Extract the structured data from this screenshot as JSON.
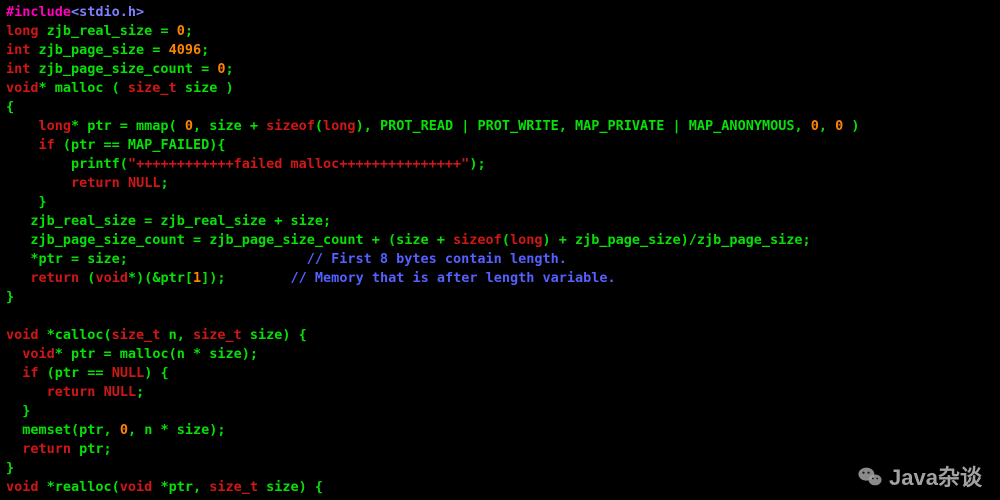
{
  "code": {
    "include_directive": "#include",
    "include_header": "<stdio.h>",
    "l2_t": "long",
    "l2_a": " zjb_real_size = ",
    "l2_v": "0",
    "l2_e": ";",
    "l3_t": "int",
    "l3_a": " zjb_page_size = ",
    "l3_v": "4096",
    "l3_e": ";",
    "l4_t": "int",
    "l4_a": " zjb_page_size_count = ",
    "l4_v": "0",
    "l4_e": ";",
    "l5_t1": "void",
    "l5_a": "* malloc ( ",
    "l5_t2": "size_t",
    "l5_b": " size )",
    "brace_open": "{",
    "brace_close": "}",
    "l7_i": "    ",
    "l7_t": "long",
    "l7_a": "* ptr = mmap( ",
    "l7_v1": "0",
    "l7_b": ", size + ",
    "l7_k": "sizeof",
    "l7_c": "(",
    "l7_t2": "long",
    "l7_d": "), PROT_READ | PROT_WRITE, MAP_PRIVATE | MAP_ANONYMOUS, ",
    "l7_v2": "0",
    "l7_com": ", ",
    "l7_v3": "0",
    "l7_e": " )",
    "l8_i": "    ",
    "l8_k": "if",
    "l8_a": " (ptr == MAP_FAILED){",
    "l9_i": "        ",
    "l9_a": "printf(",
    "l9_s": "\"++++++++++++failed malloc+++++++++++++++\"",
    "l9_b": ");",
    "l10_i": "        ",
    "l10_k": "return",
    "l10_sp": " ",
    "l10_v": "NULL",
    "l10_e": ";",
    "l11_i": "    ",
    "l11_a": "}",
    "l12_i": "   ",
    "l12_a": "zjb_real_size = zjb_real_size + size;",
    "l13_i": "   ",
    "l13_a": "zjb_page_size_count = zjb_page_size_count + (size + ",
    "l13_k": "sizeof",
    "l13_b": "(",
    "l13_t": "long",
    "l13_c": ") + zjb_page_size)/zjb_page_size;",
    "l14_i": "   ",
    "l14_a": "*ptr = size;",
    "l14_pad": "                      ",
    "l14_c": "// First 8 bytes contain length.",
    "l15_i": "   ",
    "l15_k": "return",
    "l15_a": " (",
    "l15_t": "void",
    "l15_b": "*)(&ptr[",
    "l15_v": "1",
    "l15_c": "]);",
    "l15_pad": "        ",
    "l15_cm": "// Memory that is after length variable.",
    "blank": "",
    "l18_t1": "void",
    "l18_a": " *calloc(",
    "l18_t2": "size_t",
    "l18_b": " n, ",
    "l18_t3": "size_t",
    "l18_c": " size) {",
    "l19_i": "  ",
    "l19_t": "void",
    "l19_a": "* ptr = malloc(n * size);",
    "l20_i": "  ",
    "l20_k": "if",
    "l20_a": " (ptr == ",
    "l20_v": "NULL",
    "l20_b": ") {",
    "l21_i": "     ",
    "l21_k": "return",
    "l21_sp": " ",
    "l21_v": "NULL",
    "l21_e": ";",
    "l22_i": "  ",
    "l22_a": "}",
    "l23_i": "  ",
    "l23_a": "memset(ptr, ",
    "l23_v": "0",
    "l23_b": ", n * size);",
    "l24_i": "  ",
    "l24_k": "return",
    "l24_a": " ptr;",
    "l26_t1": "void",
    "l26_a": " *realloc(",
    "l26_t2": "void",
    "l26_b": " *ptr, ",
    "l26_t3": "size_t",
    "l26_c": " size) {"
  },
  "watermark": {
    "text": "Java杂谈"
  }
}
